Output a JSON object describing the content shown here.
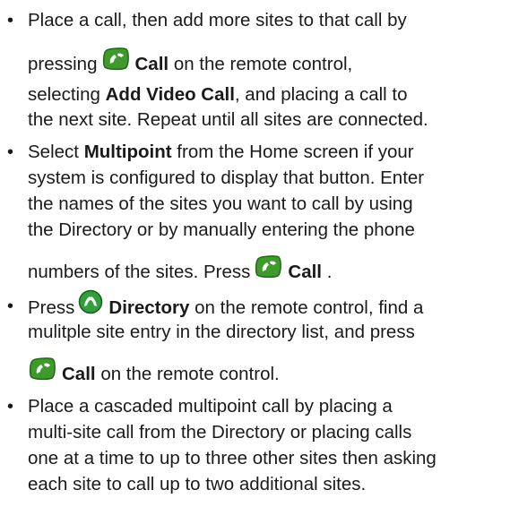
{
  "bullet_char": "•",
  "icon_colors": {
    "call_green": "#3f9a2c",
    "call_dark_green": "#1f6b14",
    "directory_green": "#2fa03a"
  },
  "items": [
    {
      "a": "Place a call, then add more sites to that call by",
      "b_pre": "pressing",
      "b_icon": "call-button-icon",
      "b_bold": "Call",
      "b_post": "on the remote control,",
      "c_bold": "Add Video Call",
      "c_pre": "selecting",
      "c_post": ", and placing a call to",
      "d": "the next site. Repeat until all sites are connected."
    },
    {
      "a_pre": "Select",
      "a_bold": "Multipoint",
      "a_post": "from the Home screen if your",
      "b": "system is configured to display that button. Enter",
      "c": "the names of the sites you want to call by using",
      "d": "the Directory or by manually entering the phone",
      "e_pre": "numbers of the sites. Press",
      "e_icon": "call-button-icon",
      "e_bold": "Call",
      "e_post": "."
    },
    {
      "a_pre": "Press",
      "a_icon": "directory-button-icon",
      "a_bold": "Directory",
      "a_post": "on the remote control, find a",
      "b": "mulitple site entry in the directory list, and press",
      "c_icon": "call-button-icon",
      "c_bold": "Call",
      "c_post": "on the remote control."
    },
    {
      "a": "Place a cascaded multipoint call by placing a",
      "b": "multi-site call from the Directory or placing calls",
      "c": "one at a time to up to three other sites then asking",
      "d": "each site to call up to two additional sites."
    }
  ]
}
